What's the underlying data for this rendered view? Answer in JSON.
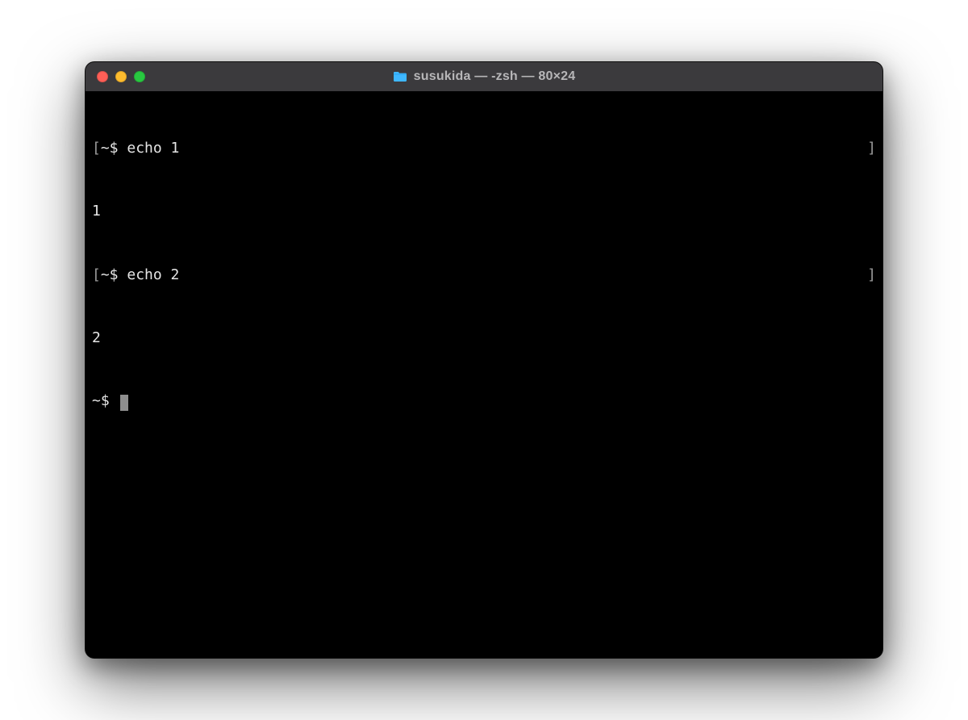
{
  "window": {
    "title": "susukida — -zsh — 80×24"
  },
  "terminal": {
    "lines": [
      {
        "type": "prompt",
        "bracket_open": "[",
        "prompt": "~$ ",
        "command": "echo 1",
        "bracket_close": "]"
      },
      {
        "type": "output",
        "text": "1"
      },
      {
        "type": "prompt",
        "bracket_open": "[",
        "prompt": "~$ ",
        "command": "echo 2",
        "bracket_close": "]"
      },
      {
        "type": "output",
        "text": "2"
      },
      {
        "type": "active",
        "prompt": "~$ "
      }
    ]
  }
}
